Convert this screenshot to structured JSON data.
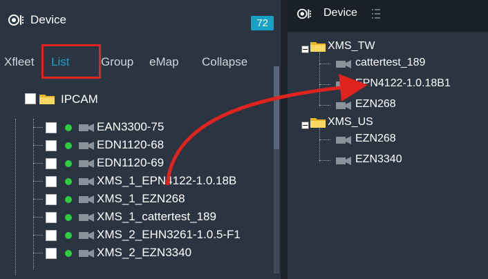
{
  "left_panel": {
    "header": {
      "title": "Device",
      "count": "72"
    },
    "tabs": [
      "Xfleet",
      "List",
      "Group",
      "eMap",
      "Collapse"
    ],
    "active_tab": "List",
    "root": {
      "label": "IPCAM"
    },
    "devices": [
      "EAN3300-75",
      "EDN1120-68",
      "EDN1120-69",
      "XMS_1_EPN4122-1.0.18B",
      "XMS_1_EZN268",
      "XMS_1_cattertest_189",
      "XMS_2_EHN3261-1.0.5-F1",
      "XMS_2_EZN3340"
    ]
  },
  "right_panel": {
    "header": {
      "title": "Device"
    },
    "groups": [
      {
        "label": "XMS_TW",
        "children": [
          "cattertest_189",
          "EPN4122-1.0.18B1",
          "EZN268"
        ]
      },
      {
        "label": "XMS_US",
        "children": [
          "EZN268",
          "EZN3340"
        ]
      }
    ]
  },
  "colors": {
    "accent": "#16a1c6",
    "highlight": "#e0231f",
    "online": "#2ecc40"
  }
}
